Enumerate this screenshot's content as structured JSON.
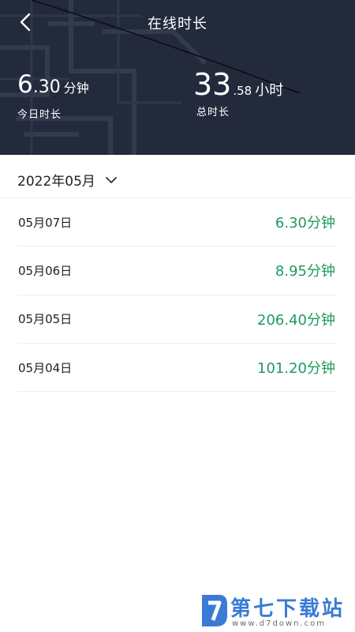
{
  "header": {
    "title": "在线时长",
    "today": {
      "value_int": "6",
      "value_dec": ".30",
      "unit": "分钟",
      "caption": "今日时长"
    },
    "total": {
      "value_int": "33",
      "value_dec": ".58",
      "unit": "小时",
      "caption": "总时长"
    }
  },
  "filter": {
    "month": "2022年05月"
  },
  "records": [
    {
      "date": "05月07日",
      "duration": "6.30分钟"
    },
    {
      "date": "05月06日",
      "duration": "8.95分钟"
    },
    {
      "date": "05月05日",
      "duration": "206.40分钟"
    },
    {
      "date": "05月04日",
      "duration": "101.20分钟"
    }
  ],
  "watermark": {
    "brand": "第七下载站",
    "url": "www.d7down.com"
  },
  "colors": {
    "header_bg": "#222a3b",
    "accent_green": "#1f9a5e",
    "watermark_blue": "#3a7bd5"
  },
  "icons": {
    "back": "chevron-left-icon",
    "dropdown": "chevron-down-icon",
    "logo": "d7-logo-icon"
  }
}
